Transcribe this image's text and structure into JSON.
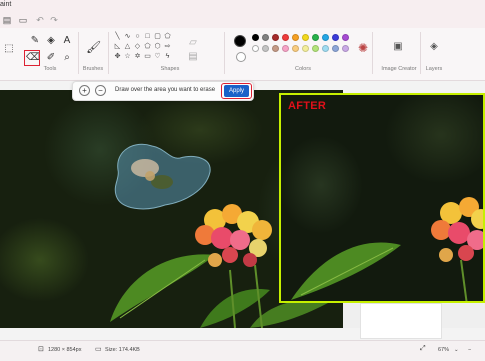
{
  "window": {
    "title": "aint"
  },
  "ribbon": {
    "groups": {
      "tools": "Tools",
      "brushes": "Brushes",
      "shapes": "Shapes",
      "colors": "Colors",
      "image_creator": "Image Creator",
      "layers": "Layers"
    },
    "palette_row1": [
      "#000000",
      "#808080",
      "#a52a2a",
      "#ef3b3b",
      "#f5a023",
      "#f2d81e",
      "#27b14a",
      "#25a7e5",
      "#3b3bd9",
      "#a64bd3"
    ],
    "palette_row2": [
      "#ffffff",
      "#c3c3c3",
      "#c59a86",
      "#f7a3c6",
      "#f9cc7e",
      "#f3ee9a",
      "#b3e47a",
      "#9fdcf2",
      "#8da6d9",
      "#c9a9e6"
    ],
    "selected_color": "#000000"
  },
  "erase_bar": {
    "message": "Draw over the area you want to erase",
    "apply_label": "Apply",
    "plus": "+",
    "minus": "−"
  },
  "after_panel": {
    "label": "AFTER"
  },
  "status": {
    "dimensions": "1280 × 854px",
    "size": "Size: 174.4KB",
    "zoom": "67%"
  }
}
